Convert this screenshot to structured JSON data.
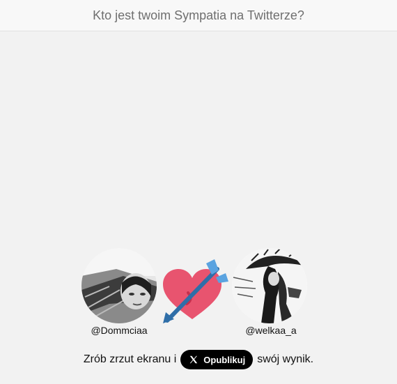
{
  "header": {
    "title": "Kto jest twoim Sympatia na Twitterze?"
  },
  "match": {
    "left_user": {
      "handle": "@Dommciaa"
    },
    "right_user": {
      "handle": "@welkaa_a"
    },
    "center_icon": "heart-with-arrow-icon"
  },
  "cta": {
    "before": "Zrób zrzut ekranu i",
    "button_label": "Opublikuj",
    "button_icon": "x-logo-icon",
    "after": "swój wynik."
  },
  "colors": {
    "background": "#f2f2f2",
    "header_bg": "#f8f8f8",
    "heart": "#e8546f",
    "arrow": "#2f6ea8",
    "button_bg": "#000000"
  }
}
